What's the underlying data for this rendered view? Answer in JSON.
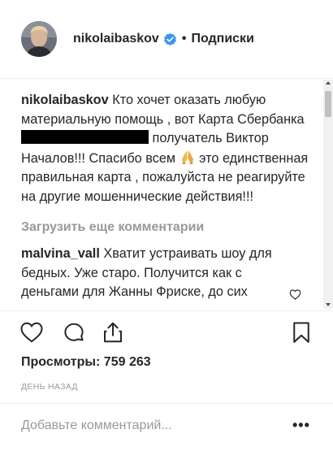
{
  "header": {
    "username": "nikolaibaskov",
    "separator": "•",
    "follow_label": "Подписки"
  },
  "caption": {
    "username": "nikolaibaskov",
    "text_part1": "Кто хочет оказать любую материальную помощь , вот Карта Сбербанка",
    "text_part2": "получатель Виктор Началов!!! Спасибо всем",
    "text_part3": "это единственная правильная карта , пожалуйста не реагируйте на другие мошеннические действия!!!"
  },
  "load_more_label": "Загрузить еще комментарии",
  "comment": {
    "username": "malvina_vall",
    "text": "Хватит устраивать шоу для бедных. Уже старо. Получится как с деньгами для Жанны Фриске, до сих"
  },
  "views": {
    "label": "Просмотры:",
    "count": "759 263"
  },
  "timestamp": "ДЕНЬ НАЗАД",
  "add_comment": {
    "placeholder": "Добавьте комментарий..."
  },
  "more_options_label": "•••",
  "icons": {
    "verified": "verified-badge-icon",
    "like": "heart-icon",
    "comment": "comment-bubble-icon",
    "share": "share-icon",
    "save": "bookmark-icon",
    "pray": "folded-hands-emoji-icon"
  },
  "colors": {
    "text": "#262626",
    "muted": "#999999",
    "verified": "#3897f0",
    "divider": "#efefef"
  }
}
